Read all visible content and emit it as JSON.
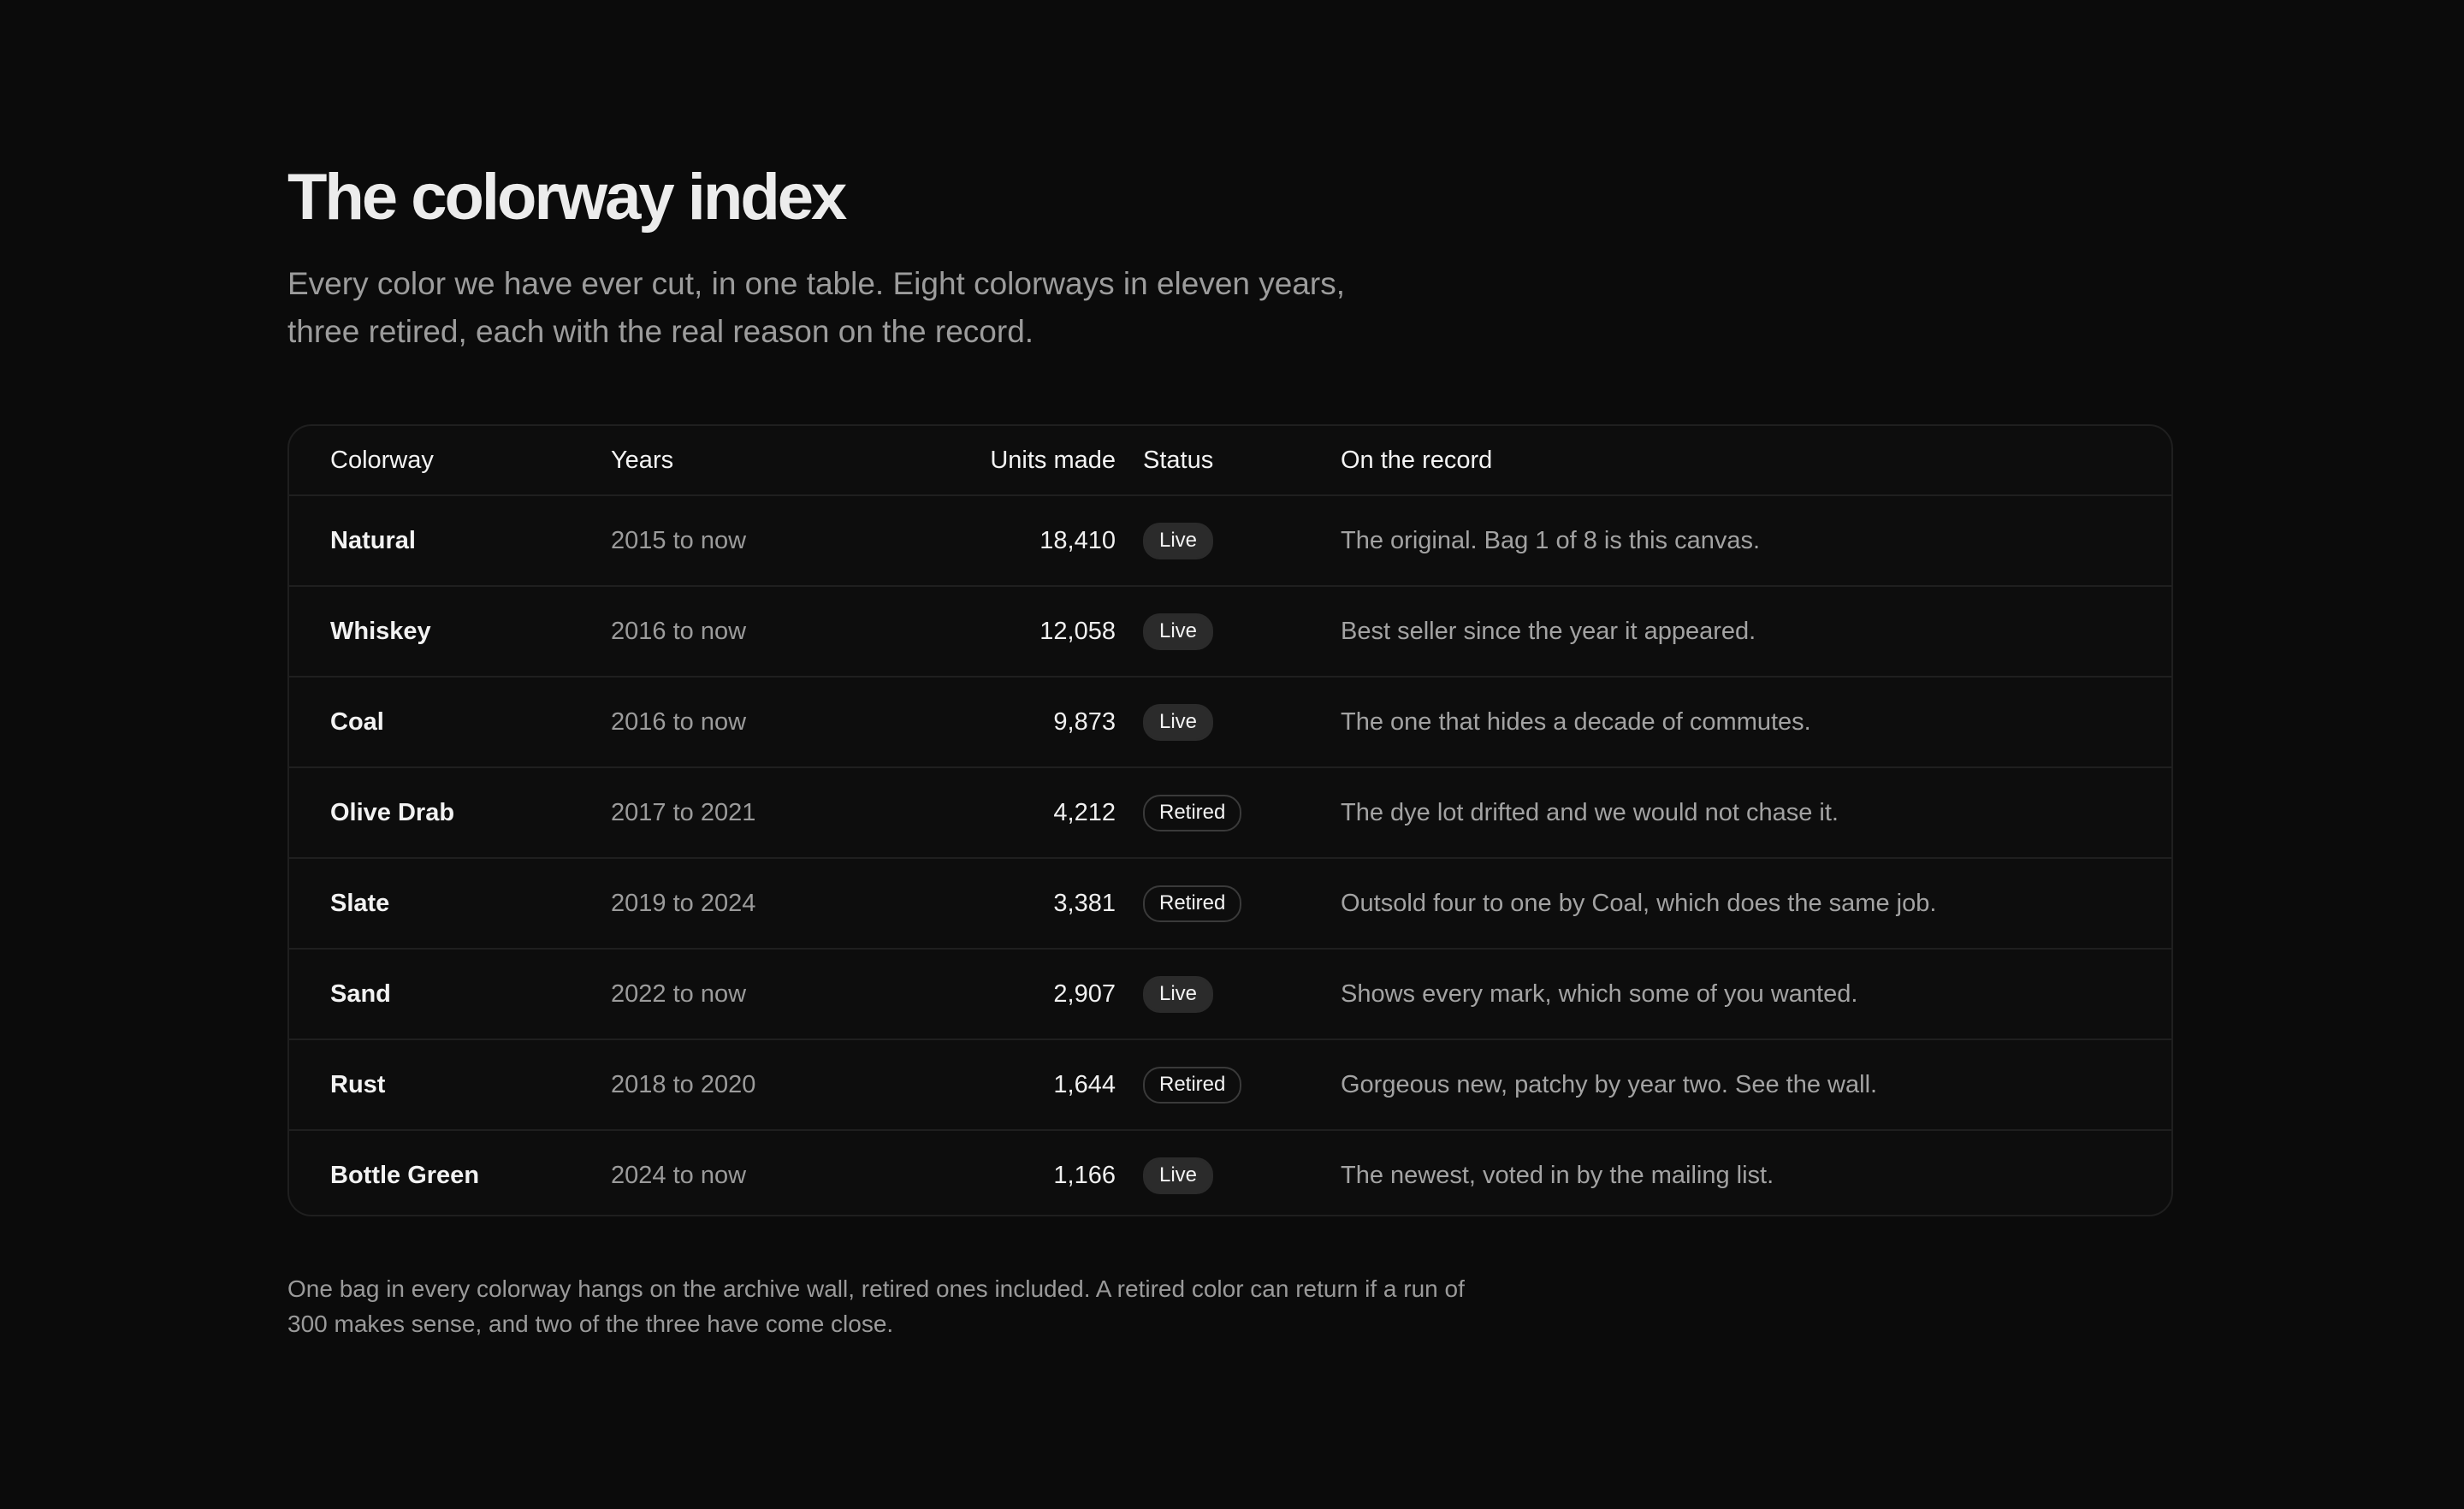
{
  "title": "The colorway index",
  "intro": "Every color we have ever cut, in one table. Eight colorways in eleven years, three retired, each with the real reason on the record.",
  "table": {
    "headers": {
      "colorway": "Colorway",
      "years": "Years",
      "units": "Units made",
      "status": "Status",
      "record": "On the record"
    },
    "rows": [
      {
        "colorway": "Natural",
        "years": "2015 to now",
        "units": "18,410",
        "status": "Live",
        "record": "The original. Bag 1 of 8 is this canvas."
      },
      {
        "colorway": "Whiskey",
        "years": "2016 to now",
        "units": "12,058",
        "status": "Live",
        "record": "Best seller since the year it appeared."
      },
      {
        "colorway": "Coal",
        "years": "2016 to now",
        "units": "9,873",
        "status": "Live",
        "record": "The one that hides a decade of commutes."
      },
      {
        "colorway": "Olive Drab",
        "years": "2017 to 2021",
        "units": "4,212",
        "status": "Retired",
        "record": "The dye lot drifted and we would not chase it."
      },
      {
        "colorway": "Slate",
        "years": "2019 to 2024",
        "units": "3,381",
        "status": "Retired",
        "record": "Outsold four to one by Coal, which does the same job."
      },
      {
        "colorway": "Sand",
        "years": "2022 to now",
        "units": "2,907",
        "status": "Live",
        "record": "Shows every mark, which some of you wanted."
      },
      {
        "colorway": "Rust",
        "years": "2018 to 2020",
        "units": "1,644",
        "status": "Retired",
        "record": "Gorgeous new, patchy by year two. See the wall."
      },
      {
        "colorway": "Bottle Green",
        "years": "2024 to now",
        "units": "1,166",
        "status": "Live",
        "record": "The newest, voted in by the mailing list."
      }
    ]
  },
  "footnote": "One bag in every colorway hangs on the archive wall, retired ones included. A retired color can return if a run of 300 makes sense, and two of the three have come close.",
  "colors": {
    "background": "#0b0b0b",
    "live_badge": "#2b2b2b",
    "retired_badge_border": "#3a3a3a"
  }
}
